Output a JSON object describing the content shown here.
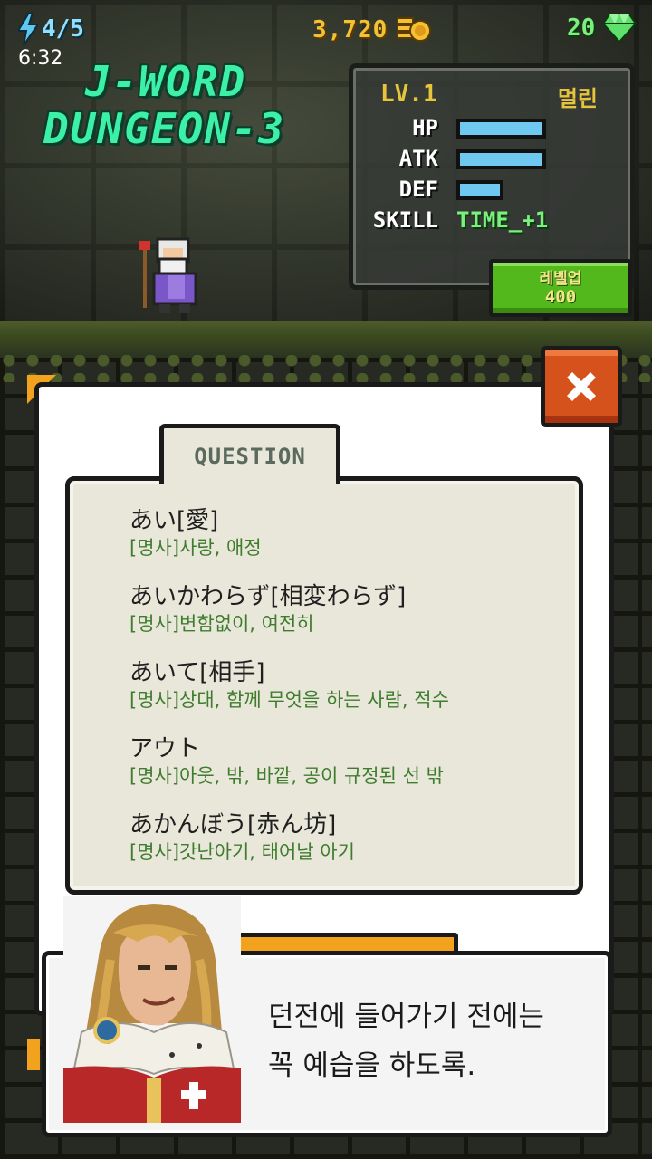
{
  "status": {
    "energy": "4/5",
    "clock": "6:32",
    "gold": "3,720",
    "gems": "20"
  },
  "title": {
    "line1": "J-WORD",
    "line2": "DUNGEON-3"
  },
  "character": {
    "level": "LV.1",
    "name": "멀린",
    "stats": [
      {
        "label": "HP",
        "fill": 0.85
      },
      {
        "label": "ATK",
        "fill": 0.85
      },
      {
        "label": "DEF",
        "fill": 0.45
      }
    ],
    "skill_label": "SKILL",
    "skill_value": "TIME_+1"
  },
  "levelup": {
    "label": "레벨업",
    "cost": "400"
  },
  "question_tab": "QUESTION",
  "words": [
    {
      "japanese": "あい[愛]",
      "meaning": "[명사]사랑, 애정"
    },
    {
      "japanese": "あいかわらず[相変わらず]",
      "meaning": "[명사]변함없이, 여전히"
    },
    {
      "japanese": "あいて[相手]",
      "meaning": "[명사]상대, 함께 무엇을 하는 사람, 적수"
    },
    {
      "japanese": "アウト",
      "meaning": "[명사]아웃, 밖, 바깥, 공이 규정된 선 밖"
    },
    {
      "japanese": "あかんぼう[赤ん坊]",
      "meaning": "[명사]갓난아기, 태어날 아기"
    }
  ],
  "dialog": {
    "line1": "던전에 들어가기 전에는",
    "line2": "꼭 예습을 하도록."
  },
  "colors": {
    "accent_orange": "#f2a21c",
    "close_red": "#d6521c",
    "levelup_green": "#53b81c",
    "meaning_green": "#3f7d2e",
    "bar_blue": "#6fc8f0"
  }
}
